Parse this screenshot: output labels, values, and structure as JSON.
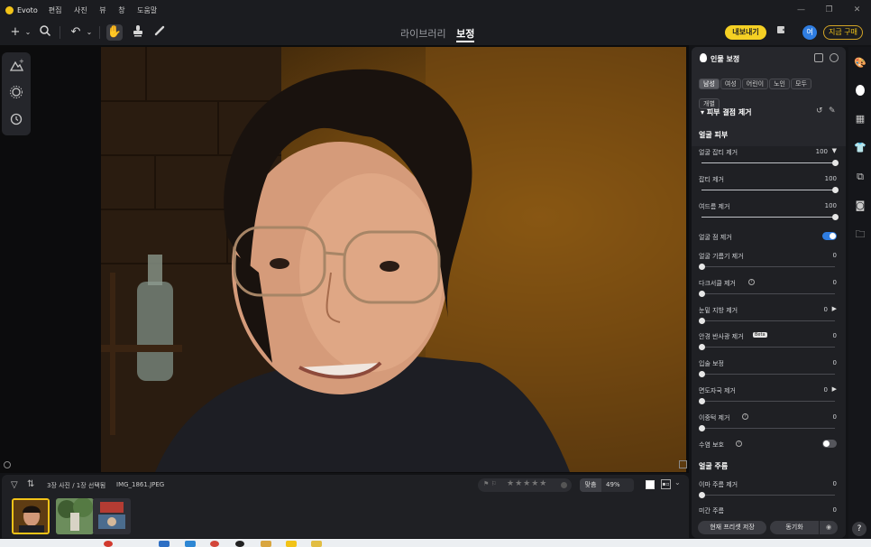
{
  "app": {
    "name": "Evoto",
    "menu": [
      "편집",
      "사진",
      "뷰",
      "창",
      "도움말"
    ]
  },
  "window_controls": [
    "—",
    "❐",
    "✕"
  ],
  "toolbar": {
    "tabs": [
      {
        "label": "라이브러리",
        "active": false
      },
      {
        "label": "보정",
        "active": true
      }
    ],
    "export_label": "내보내기",
    "avatar_letter": "여",
    "buy_label": "지금 구매"
  },
  "filmstrip": {
    "photo_count": "3장 사진 / 1장 선택됨",
    "file_name": "IMG_1861.JPEG",
    "fit_label": "맞춤",
    "zoom": "49%",
    "rating": 0
  },
  "panel": {
    "title": "인물 보정",
    "chips": [
      {
        "label": "남성",
        "active": true
      },
      {
        "label": "여성",
        "active": false
      },
      {
        "label": "어린이",
        "active": false
      },
      {
        "label": "노인",
        "active": false
      },
      {
        "label": "모두",
        "active": false
      },
      {
        "label": "개별",
        "active": false
      }
    ],
    "section_title": "피부 결점 제거",
    "group_face_skin": "얼굴 피부",
    "group_wrinkles": "얼굴 주름",
    "rows": [
      {
        "label": "얼굴 잡티 제거",
        "value": "100",
        "dropdown": true
      },
      {
        "label": "잡티 제거",
        "value": "100"
      },
      {
        "label": "여드름 제거",
        "value": "100"
      },
      {
        "label": "얼굴 점 제거",
        "toggle": true
      },
      {
        "label": "얼굴 기름기 제거",
        "value": "0"
      },
      {
        "label": "다크서클 제거",
        "value": "0",
        "help": true
      },
      {
        "label": "눈밑 지방 제거",
        "value": "0",
        "expand": true
      },
      {
        "label": "안경 반사광 제거",
        "value": "0",
        "beta": "Beta"
      },
      {
        "label": "입술 보정",
        "value": "0"
      },
      {
        "label": "면도자국 제거",
        "value": "0",
        "expand": true
      },
      {
        "label": "이중턱 제거",
        "value": "0",
        "help": true
      },
      {
        "label": "수염 보호",
        "toggle": false,
        "help": true
      },
      {
        "label": "이마 주름 제거",
        "value": "0"
      },
      {
        "label": "미간 주름",
        "value": "0"
      }
    ],
    "save_label": "현재 프리셋 저장",
    "sync_label": "동기화"
  },
  "colors": {
    "accent": "#f2c318",
    "toggle_on": "#2f7de1"
  }
}
